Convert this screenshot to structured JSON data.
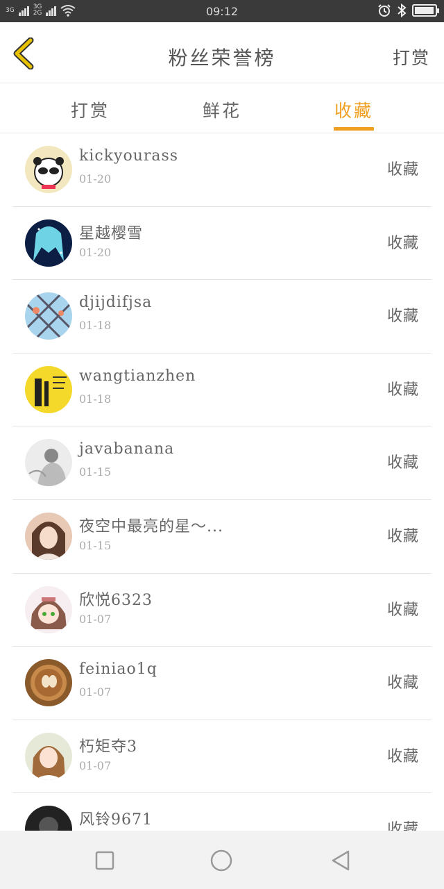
{
  "status": {
    "net1": "3G",
    "net2_top": "3G",
    "net2_bottom": "2G",
    "time": "09:12",
    "battery_level": 0.95
  },
  "header": {
    "title": "粉丝荣誉榜",
    "action": "打赏"
  },
  "tabs": [
    {
      "label": "打赏",
      "active": false
    },
    {
      "label": "鲜花",
      "active": false
    },
    {
      "label": "收藏",
      "active": true
    }
  ],
  "list": [
    {
      "name": "kickyourass",
      "date": "01-20",
      "action": "收藏"
    },
    {
      "name": "星越樱雪",
      "date": "01-20",
      "action": "收藏"
    },
    {
      "name": "djijdifjsa",
      "date": "01-18",
      "action": "收藏"
    },
    {
      "name": "wangtianzhen",
      "date": "01-18",
      "action": "收藏"
    },
    {
      "name": "javabanana",
      "date": "01-15",
      "action": "收藏"
    },
    {
      "name": "夜空中最亮的星～...",
      "date": "01-15",
      "action": "收藏"
    },
    {
      "name": "欣悦6323",
      "date": "01-07",
      "action": "收藏"
    },
    {
      "name": "feiniao1q",
      "date": "01-07",
      "action": "收藏"
    },
    {
      "name": "朽矩夺3",
      "date": "01-07",
      "action": "收藏"
    },
    {
      "name": "风铃9671",
      "date": "",
      "action": "收藏"
    }
  ],
  "colors": {
    "accent": "#f0a020",
    "back_arrow": "#e8c200",
    "status_bar": "#3a3a3a"
  }
}
